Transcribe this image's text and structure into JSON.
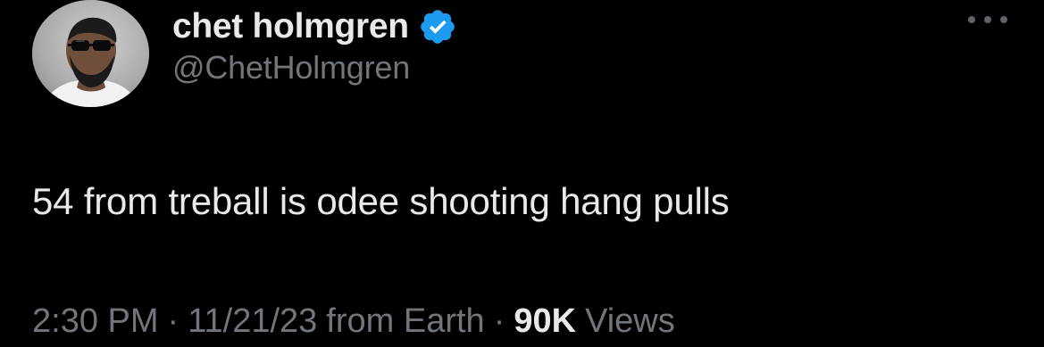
{
  "tweet": {
    "author": {
      "display_name": "chet holmgren",
      "handle": "@ChetHolmgren",
      "verified": true,
      "avatar_icon": "profile-photo"
    },
    "text": "54 from treball is odee shooting hang pulls",
    "meta": {
      "time": "2:30 PM",
      "date": "11/21/23",
      "source": "from Earth",
      "views_count": "90K",
      "views_label": "Views",
      "separator": "·"
    },
    "actions": {
      "more_icon": "more-horizontal-icon"
    }
  },
  "colors": {
    "background": "#000000",
    "primary_text": "#e7e9ea",
    "secondary_text": "#71767b",
    "verified_blue": "#1d9bf0"
  }
}
